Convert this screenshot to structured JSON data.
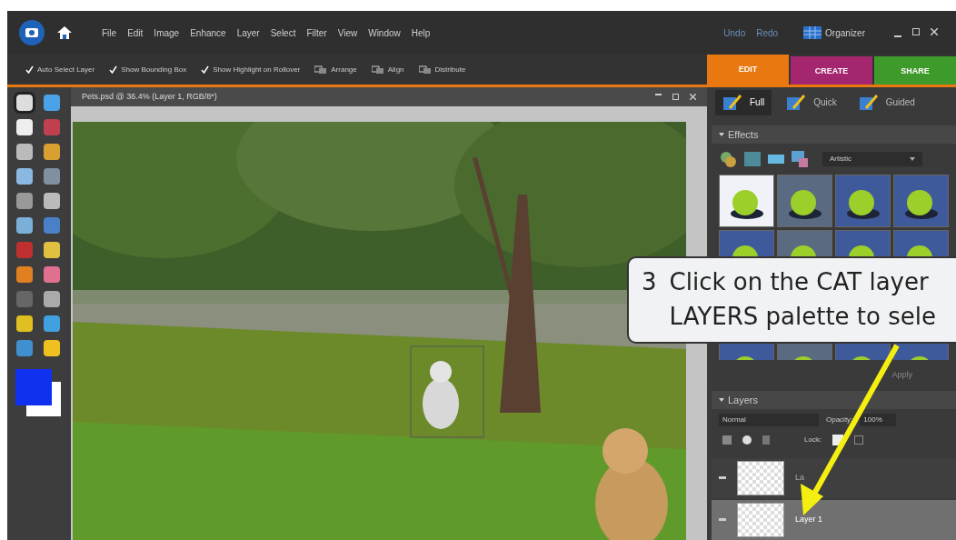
{
  "menu": [
    "File",
    "Edit",
    "Image",
    "Enhance",
    "Layer",
    "Select",
    "Filter",
    "View",
    "Window",
    "Help"
  ],
  "history": [
    "Undo",
    "Redo"
  ],
  "organizer": "Organizer",
  "options": [
    {
      "kind": "check",
      "label": "Auto Select Layer",
      "checked": true
    },
    {
      "kind": "check",
      "label": "Show Bounding Box",
      "checked": true
    },
    {
      "kind": "check",
      "label": "Show Highlight on Rollover",
      "checked": true
    },
    {
      "kind": "menu",
      "label": "Arrange"
    },
    {
      "kind": "menu",
      "label": "Align"
    },
    {
      "kind": "menu",
      "label": "Distribute"
    }
  ],
  "mode_tabs": [
    {
      "label": "EDIT",
      "selected": true,
      "color": "#e8780f"
    },
    {
      "label": "CREATE",
      "selected": false,
      "color": "#a3266f"
    },
    {
      "label": "SHARE",
      "selected": false,
      "color": "#3f9a2c"
    }
  ],
  "document": {
    "title": "Pets.psd @ 36.4% (Layer 1, RGB/8*)"
  },
  "edit_tabs": [
    {
      "label": "Full",
      "selected": true
    },
    {
      "label": "Quick",
      "selected": false
    },
    {
      "label": "Guided",
      "selected": false
    }
  ],
  "effects": {
    "title": "Effects",
    "category": "Artistic",
    "apply": "Apply"
  },
  "layers": {
    "title": "Layers",
    "blend_mode": "Normal",
    "opacity_label": "Opacity:",
    "opacity": "100%",
    "lock_label": "Lock:",
    "items": [
      {
        "name": "La",
        "selected": false
      },
      {
        "name": "Layer 1",
        "selected": true
      }
    ]
  },
  "callout": {
    "number": "3",
    "lines": [
      "Click on the CAT layer",
      "LAYERS palette to sele"
    ]
  }
}
